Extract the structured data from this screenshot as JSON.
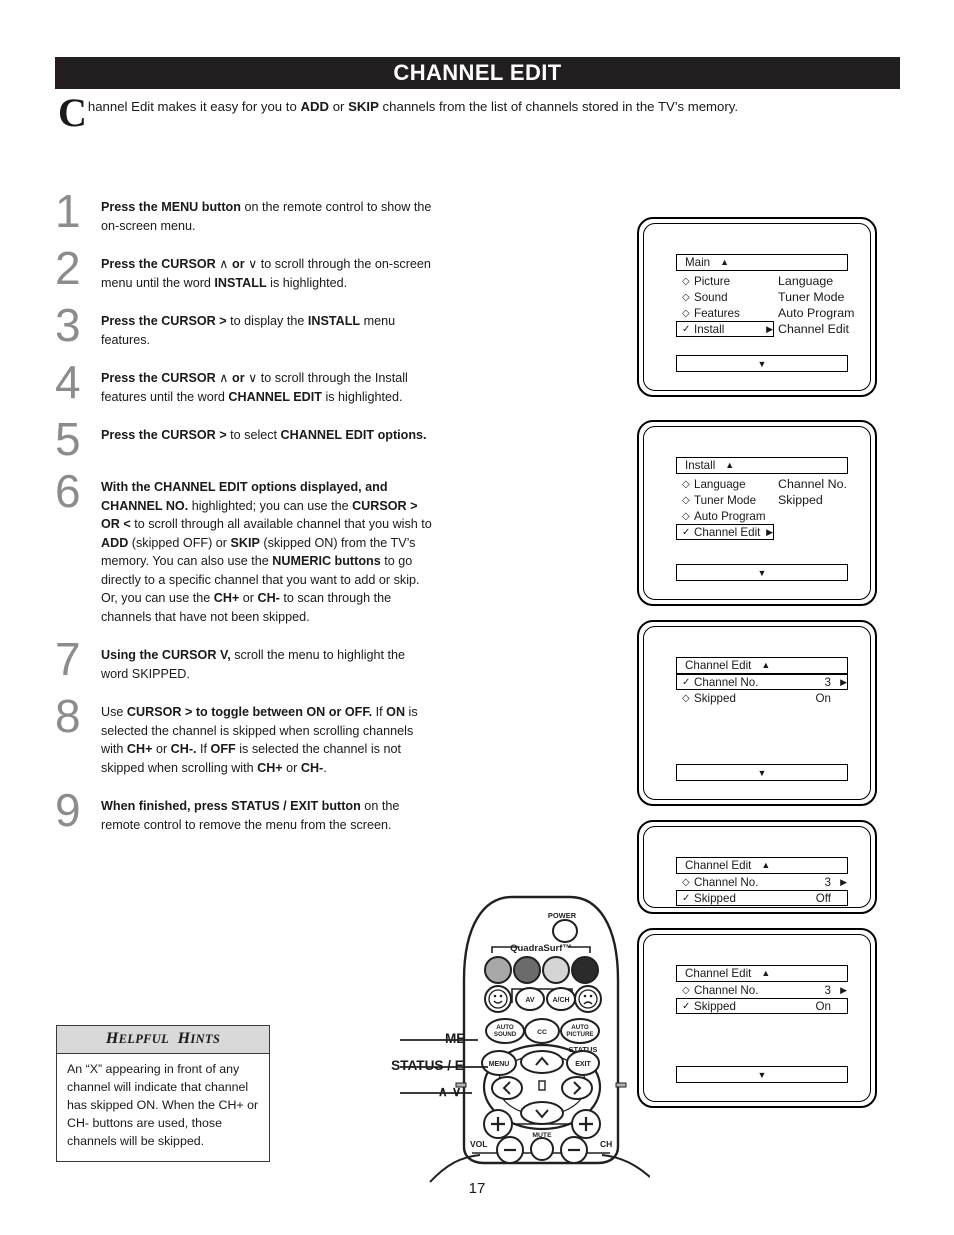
{
  "page": {
    "title": "CHANNEL EDIT",
    "number": "17",
    "intro_dropcap": "C",
    "intro_parts": [
      {
        "t": "hannel Edit makes it easy for you to ",
        "b": false
      },
      {
        "t": "ADD",
        "b": true
      },
      {
        "t": " or ",
        "b": false
      },
      {
        "t": "SKIP",
        "b": true
      },
      {
        "t": " channels from the list of channels stored in the TV’s memory.",
        "b": false
      }
    ]
  },
  "steps": [
    {
      "num": "1",
      "parts": [
        {
          "t": "Press the MENU button",
          "b": true
        },
        {
          "t": " on the remote control to show the on-screen menu.",
          "b": false
        }
      ]
    },
    {
      "num": "2",
      "parts": [
        {
          "t": "Press the CURSOR",
          "b": true
        },
        {
          "t": "  ∧  ",
          "b": false
        },
        {
          "t": "or",
          "b": true
        },
        {
          "t": "  ∨  to scroll through the on-screen menu until the word ",
          "b": false
        },
        {
          "t": "INSTALL",
          "b": true
        },
        {
          "t": " is highlighted.",
          "b": false
        }
      ]
    },
    {
      "num": "3",
      "parts": [
        {
          "t": "Press the CURSOR >",
          "b": true
        },
        {
          "t": "  to display the ",
          "b": false
        },
        {
          "t": "INSTALL",
          "b": true
        },
        {
          "t": " menu features.",
          "b": false
        }
      ]
    },
    {
      "num": "4",
      "parts": [
        {
          "t": "Press the CURSOR",
          "b": true
        },
        {
          "t": " ∧  ",
          "b": false
        },
        {
          "t": "or",
          "b": true
        },
        {
          "t": "  ∨ to scroll through the Install features until the word ",
          "b": false
        },
        {
          "t": "CHANNEL EDIT",
          "b": true
        },
        {
          "t": " is highlighted.",
          "b": false
        }
      ]
    },
    {
      "num": "5",
      "parts": [
        {
          "t": "Press the CURSOR >",
          "b": true
        },
        {
          "t": " to select ",
          "b": false
        },
        {
          "t": "CHANNEL EDIT options.",
          "b": true
        }
      ]
    },
    {
      "num": "6",
      "parts": [
        {
          "t": "With the CHANNEL EDIT options displayed, and CHANNEL NO.",
          "b": true
        },
        {
          "t": " highlighted; you can use the ",
          "b": false
        },
        {
          "t": "CURSOR > OR <",
          "b": true
        },
        {
          "t": " to scroll through all available channel that you wish to ",
          "b": false
        },
        {
          "t": "ADD",
          "b": true
        },
        {
          "t": " (skipped OFF) or ",
          "b": false
        },
        {
          "t": "SKIP",
          "b": true
        },
        {
          "t": " (skipped ON) from the TV’s memory.  You can also use the ",
          "b": false
        },
        {
          "t": "NUMERIC buttons",
          "b": true
        },
        {
          "t": " to go directly to a specific channel that you want to add or skip.  Or, you can use the ",
          "b": false
        },
        {
          "t": "CH+",
          "b": true
        },
        {
          "t": " or ",
          "b": false
        },
        {
          "t": "CH-",
          "b": true
        },
        {
          "t": " to scan through the channels that have not been skipped.",
          "b": false
        }
      ]
    },
    {
      "num": "7",
      "parts": [
        {
          "t": "Using the CURSOR V,",
          "b": true
        },
        {
          "t": " scroll the menu to highlight the word SKIPPED.",
          "b": false
        }
      ]
    },
    {
      "num": "8",
      "parts": [
        {
          "t": "Use ",
          "b": false
        },
        {
          "t": "CURSOR > to toggle between ON or OFF.",
          "b": true
        },
        {
          "t": "  If ",
          "b": false
        },
        {
          "t": "ON",
          "b": true
        },
        {
          "t": " is selected the channel is skipped when scrolling channels with ",
          "b": false
        },
        {
          "t": "CH+",
          "b": true
        },
        {
          "t": " or ",
          "b": false
        },
        {
          "t": "CH-.",
          "b": true
        },
        {
          "t": " If ",
          "b": false
        },
        {
          "t": "OFF",
          "b": true
        },
        {
          "t": " is selected the channel is not skipped when scrolling with ",
          "b": false
        },
        {
          "t": "CH+",
          "b": true
        },
        {
          "t": " or ",
          "b": false
        },
        {
          "t": "CH-",
          "b": true
        },
        {
          "t": ".",
          "b": false
        }
      ]
    },
    {
      "num": "9",
      "parts": [
        {
          "t": "When finished, press STATUS / EXIT button",
          "b": true
        },
        {
          "t": " on the remote control to remove the menu from the screen.",
          "b": false
        }
      ]
    }
  ],
  "hints": {
    "heading_first": "H",
    "heading_first_rest": "ELPFUL",
    "heading_second": "H",
    "heading_second_rest": "INTS",
    "body": "An “X” appearing in front of any channel will indicate that channel has skipped ON.  When the CH+ or CH- buttons are used, those channels will be skipped."
  },
  "screens": [
    {
      "name": "main-menu",
      "menu_title": "Main",
      "up_caret": "▲",
      "down_caret": "▼",
      "left_items": [
        {
          "mark": "◇",
          "label": "Picture",
          "selected": false,
          "caret": ""
        },
        {
          "mark": "◇",
          "label": "Sound",
          "selected": false,
          "caret": ""
        },
        {
          "mark": "◇",
          "label": "Features",
          "selected": false,
          "caret": ""
        },
        {
          "mark": "✓",
          "label": "Install",
          "selected": true,
          "caret": "▶"
        }
      ],
      "right_items": [
        "Language",
        "Tuner Mode",
        "Auto Program",
        "Channel Edit"
      ]
    },
    {
      "name": "install-menu",
      "menu_title": "Install",
      "up_caret": "▲",
      "down_caret": "▼",
      "left_items": [
        {
          "mark": "◇",
          "label": "Language",
          "selected": false,
          "caret": ""
        },
        {
          "mark": "◇",
          "label": "Tuner Mode",
          "selected": false,
          "caret": ""
        },
        {
          "mark": "◇",
          "label": "Auto Program",
          "selected": false,
          "caret": ""
        },
        {
          "mark": "✓",
          "label": "Channel Edit",
          "selected": true,
          "caret": "▶"
        }
      ],
      "right_items": [
        "Channel No.",
        "Skipped"
      ]
    },
    {
      "name": "channel-edit-channel-no",
      "menu_title": "Channel Edit",
      "up_caret": "▲",
      "down_caret": "▼",
      "rows": [
        {
          "mark": "✓",
          "label": "Channel No.",
          "value": "3",
          "caret": "▶",
          "selected": true
        },
        {
          "mark": "◇",
          "label": "Skipped",
          "value": "On",
          "caret": "",
          "selected": false
        }
      ]
    },
    {
      "name": "channel-edit-skipped-off",
      "menu_title": "Channel Edit",
      "up_caret": "▲",
      "down_caret": "▼",
      "rows": [
        {
          "mark": "◇",
          "label": "Channel No.",
          "value": "3",
          "caret": "▶",
          "selected": false
        },
        {
          "mark": "✓",
          "label": "Skipped",
          "value": "Off",
          "caret": "",
          "selected": true
        }
      ]
    },
    {
      "name": "channel-edit-skipped-on",
      "menu_title": "Channel Edit",
      "up_caret": "▲",
      "down_caret": "▼",
      "rows": [
        {
          "mark": "◇",
          "label": "Channel No.",
          "value": "3",
          "caret": "▶",
          "selected": false
        },
        {
          "mark": "✓",
          "label": "Skipped",
          "value": "On",
          "caret": "",
          "selected": true
        }
      ]
    }
  ],
  "callouts": [
    "MENU",
    "STATUS / EXIT",
    "∧ ∨ < >"
  ],
  "remote": {
    "power_label": "POWER",
    "brand_label": "QuadraSurf™",
    "surf_colors": [
      "#a8a8a8",
      "#6b6b6b",
      "#d6d6d6",
      "#2b2b2b"
    ],
    "row2": [
      "smiley-happy",
      "AV",
      "A/CH",
      "smiley-sad"
    ],
    "row3": [
      "AUTO SOUND",
      "CC",
      "AUTO PICTURE"
    ],
    "menu_label": "MENU",
    "status_label": "STATUS",
    "exit_label": "EXIT",
    "mute_label": "MUTE",
    "vol_label": "VOL",
    "ch_label": "CH",
    "plus": "+",
    "minus": "−",
    "cursor_up": "∧",
    "cursor_down": "∨",
    "cursor_left": "‹",
    "cursor_right": "›"
  }
}
